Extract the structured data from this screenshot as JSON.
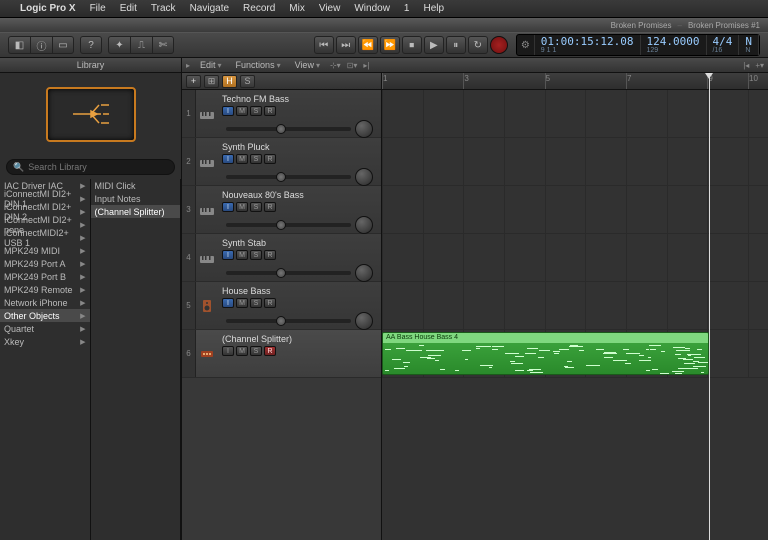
{
  "menu": {
    "app": "Logic Pro X",
    "items": [
      "File",
      "Edit",
      "Track",
      "Navigate",
      "Record",
      "Mix",
      "View",
      "Window",
      "1",
      "Help"
    ]
  },
  "project": {
    "name": "Broken Promises",
    "alt": "Broken Promises #1"
  },
  "lcd": {
    "time": "01:00:15:12.08",
    "beats": "9 1 1",
    "tempo": "124.0000",
    "tempo2": "129",
    "sig": "4/4",
    "sig2": "/16",
    "key": "N",
    "key2": "N"
  },
  "library": {
    "title": "Library",
    "search_placeholder": "Search Library",
    "col1": [
      {
        "l": "IAC Driver IAC",
        "a": true
      },
      {
        "l": "iConnectMI DI2+ DIN 1",
        "a": true
      },
      {
        "l": "iConnectMI DI2+ DIN 2",
        "a": true
      },
      {
        "l": "IConnectMI DI2+ none",
        "a": true
      },
      {
        "l": "iConnectMIDI2+ USB 1",
        "a": true
      },
      {
        "l": "MPK249 MIDI",
        "a": true
      },
      {
        "l": "MPK249 Port A",
        "a": true
      },
      {
        "l": "MPK249 Port B",
        "a": true
      },
      {
        "l": "MPK249 Remote",
        "a": true
      },
      {
        "l": "Network iPhone",
        "a": true
      },
      {
        "l": "Other Objects",
        "a": true,
        "sel": true
      },
      {
        "l": "Quartet",
        "a": true
      },
      {
        "l": "Xkey",
        "a": true
      }
    ],
    "col2": [
      {
        "l": "MIDI Click"
      },
      {
        "l": "Input Notes"
      },
      {
        "l": "(Channel Splitter)",
        "sel": true
      }
    ]
  },
  "arrange": {
    "menus": [
      "Edit",
      "Functions",
      "View"
    ],
    "buttons": {
      "plus": "+",
      "grid": "⊞",
      "h": "H",
      "s": "S"
    },
    "ruler": [
      1,
      3,
      5,
      7,
      9,
      10
    ]
  },
  "tracks": [
    {
      "n": "1",
      "name": "Techno FM Bass",
      "icon": "keys",
      "i": true
    },
    {
      "n": "2",
      "name": "Synth Pluck",
      "icon": "keys",
      "i": true
    },
    {
      "n": "3",
      "name": "Nouveaux 80's Bass",
      "icon": "keys",
      "i": true
    },
    {
      "n": "4",
      "name": "Synth Stab",
      "icon": "keys",
      "i": true
    },
    {
      "n": "5",
      "name": "House Bass",
      "icon": "speaker",
      "i": true
    },
    {
      "n": "6",
      "name": "(Channel Splitter)",
      "icon": "splitter",
      "sel": true,
      "r": true
    }
  ],
  "region": {
    "name": "AA Bass House Bass 4"
  }
}
